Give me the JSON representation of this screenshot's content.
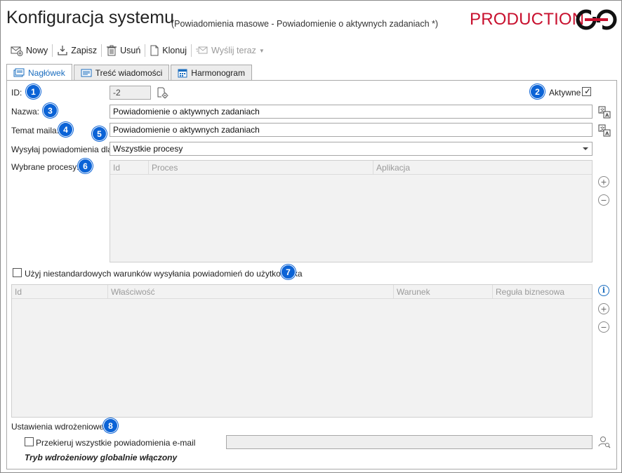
{
  "window": {
    "title": "Konfiguracja systemu",
    "subtitle": "(Powiadomienia masowe - Powiadomienie o aktywnych zadaniach *)",
    "environment": "PRODUCTION"
  },
  "toolbar": {
    "new_label": "Nowy",
    "save_label": "Zapisz",
    "delete_label": "Usuń",
    "clone_label": "Klonuj",
    "send_now_label": "Wyślij teraz"
  },
  "tabs": [
    {
      "label": "Nagłówek",
      "active": true
    },
    {
      "label": "Treść wiadomości",
      "active": false
    },
    {
      "label": "Harmonogram",
      "active": false
    }
  ],
  "form": {
    "id_label": "ID:",
    "id_value": "-2",
    "active_label": "Aktywne",
    "active_checked": true,
    "name_label": "Nazwa:",
    "name_value": "Powiadomienie o aktywnych zadaniach",
    "subject_label": "Temat maila:",
    "subject_value": "Powiadomienie o aktywnych zadaniach",
    "send_for_label": "Wysyłaj powiadomienia dla:",
    "send_for_value": "Wszystkie procesy",
    "selected_processes_label": "Wybrane procesy:",
    "processes_columns": [
      "Id",
      "Proces",
      "Aplikacja"
    ],
    "processes_rows": [],
    "custom_conditions_label": "Użyj niestandardowych warunków wysyłania powiadomień do użytkownika",
    "custom_conditions_checked": false,
    "conditions_columns": [
      "Id",
      "Właściwość",
      "Warunek",
      "Reguła biznesowa"
    ],
    "conditions_rows": [],
    "deployment_label": "Ustawienia wdrożeniowe:",
    "redirect_label": "Przekieruj wszystkie powiadomienia e-mail",
    "redirect_checked": false,
    "redirect_value": "",
    "deployment_mode_text": "Tryb wdrożeniowy globalnie włączony"
  },
  "badges": [
    "1",
    "2",
    "3",
    "4",
    "5",
    "6",
    "7",
    "8"
  ],
  "colors": {
    "accent": "#1a6dbf",
    "badge": "#0b63d6",
    "environment": "#c8102e"
  },
  "icons": [
    "new-mail-icon",
    "save-icon",
    "trash-icon",
    "clone-icon",
    "send-icon",
    "header-tab-icon",
    "message-tab-icon",
    "calendar-icon",
    "id-settings-icon",
    "translate-icon",
    "add-icon",
    "remove-icon",
    "info-icon",
    "user-search-icon"
  ]
}
